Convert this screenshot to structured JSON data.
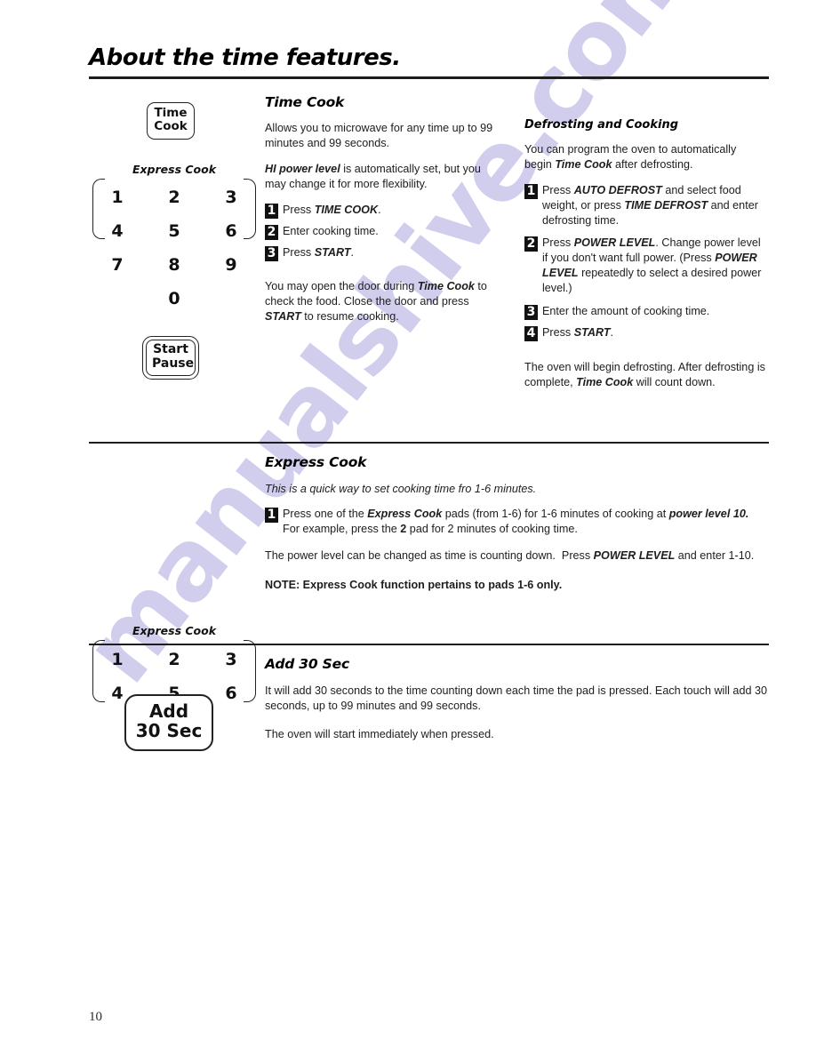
{
  "page": {
    "title": "About the time features.",
    "number": "10",
    "watermark": "manualshive.com"
  },
  "sections": [
    {
      "id": "time-cook",
      "heading": "Time Cook",
      "paragraphs": [
        "Allows you to microwave for any time up to 99 minutes and 99 seconds.",
        "HI power level is automatically set, but you may change it for more flexibility."
      ],
      "steps": [
        {
          "num": "1",
          "text": "Press TIME COOK."
        },
        {
          "num": "2",
          "text": "Enter cooking time."
        },
        {
          "num": "3",
          "text": "Press START."
        }
      ],
      "closing": "You may open the door during Time Cook to check the food. Close the door and press START to resume cooking.",
      "right": {
        "heading": "Defrosting and Cooking",
        "intro": "You can program the oven to automatically begin Time Cook after defrosting.",
        "steps": [
          {
            "num": "1",
            "text": "Press AUTO DEFROST and select food weight, or press TIME DEFROST and enter defrosting time."
          },
          {
            "num": "2",
            "text": "Press POWER LEVEL. Change power level if you don't want full power. (Press POWER LEVEL repeatedly to select a desired power level.)"
          },
          {
            "num": "3",
            "text": "Enter the amount of cooking time."
          },
          {
            "num": "4",
            "text": "Press START."
          }
        ],
        "closing": "The oven will begin defrosting. After defrosting is complete, Time Cook will count down."
      }
    },
    {
      "id": "express-cook",
      "heading": "Express Cook",
      "intro": "This is a quick way to set cooking time fro 1-6 minutes.",
      "steps": [
        {
          "num": "1",
          "text": "Press one of the Express Cook pads (from 1-6) for 1-6 minutes of cooking at power level 10.  For example, press the 2 pad for 2 minutes of cooking time."
        }
      ],
      "body": "The power level can be changed as time is counting down.  Press POWER LEVEL and enter 1-10.",
      "note": "NOTE:  Express Cook function pertains to pads 1-6 only."
    },
    {
      "id": "add-30-sec",
      "heading": "Add 30 Sec",
      "paragraphs": [
        "It will add 30 seconds to the time counting down each time the pad is pressed.   Each touch will add 30 seconds, up to 99 minutes and 99 seconds.",
        "The oven will start immediately when pressed."
      ]
    }
  ],
  "art": {
    "time_cook_button": {
      "line1": "Time",
      "line2": "Cook"
    },
    "start_pause_button": {
      "line1": "Start",
      "line2": "Pause"
    },
    "add_30_sec_button": {
      "line1": "Add",
      "line2": "30 Sec"
    },
    "express_cook_label": "Express Cook",
    "keypad_full": {
      "rows": [
        [
          "1",
          "2",
          "3"
        ],
        [
          "4",
          "5",
          "6"
        ],
        [
          "7",
          "8",
          "9"
        ],
        [
          "",
          "0",
          ""
        ]
      ]
    },
    "keypad_express": {
      "rows": [
        [
          "1",
          "2",
          "3"
        ],
        [
          "4",
          "5",
          "6"
        ]
      ]
    }
  }
}
